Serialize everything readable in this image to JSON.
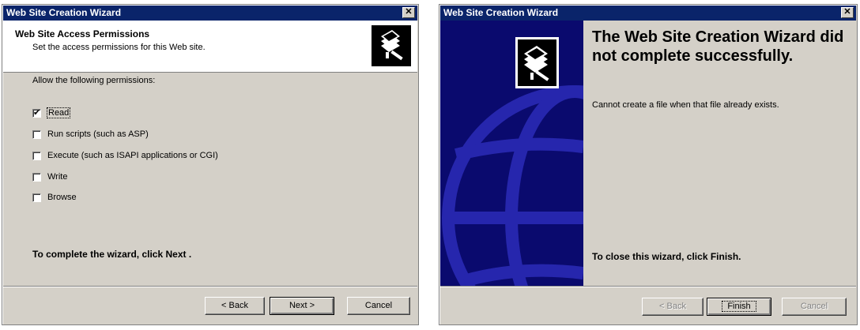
{
  "left_window": {
    "title": "Web Site Creation Wizard",
    "close_glyph": "✕",
    "header": {
      "title": "Web Site Access Permissions",
      "subtitle": "Set the access permissions for this Web site.",
      "icon": "wizard-book-icon"
    },
    "allow_label": "Allow the following permissions:",
    "checkboxes": [
      {
        "label": "Read",
        "checked": true
      },
      {
        "label": "Run scripts (such as ASP)",
        "checked": false
      },
      {
        "label": "Execute (such as ISAPI applications or CGI)",
        "checked": false
      },
      {
        "label": "Write",
        "checked": false
      },
      {
        "label": "Browse",
        "checked": false
      }
    ],
    "instruction": "To complete the wizard, click Next .",
    "buttons": {
      "back": "< Back",
      "next": "Next >",
      "cancel": "Cancel"
    }
  },
  "right_window": {
    "title": "Web Site Creation Wizard",
    "close_glyph": "✕",
    "heading": "The Web Site Creation Wizard did not complete successfully.",
    "error_message": "Cannot create a file when that file already exists.",
    "instruction": "To close this wizard, click Finish.",
    "buttons": {
      "back": "< Back",
      "finish": "Finish",
      "cancel": "Cancel"
    },
    "side_panel_color": "#0a0a6e"
  },
  "colors": {
    "titlebar": "#0a246a",
    "face": "#d4d0c8"
  }
}
